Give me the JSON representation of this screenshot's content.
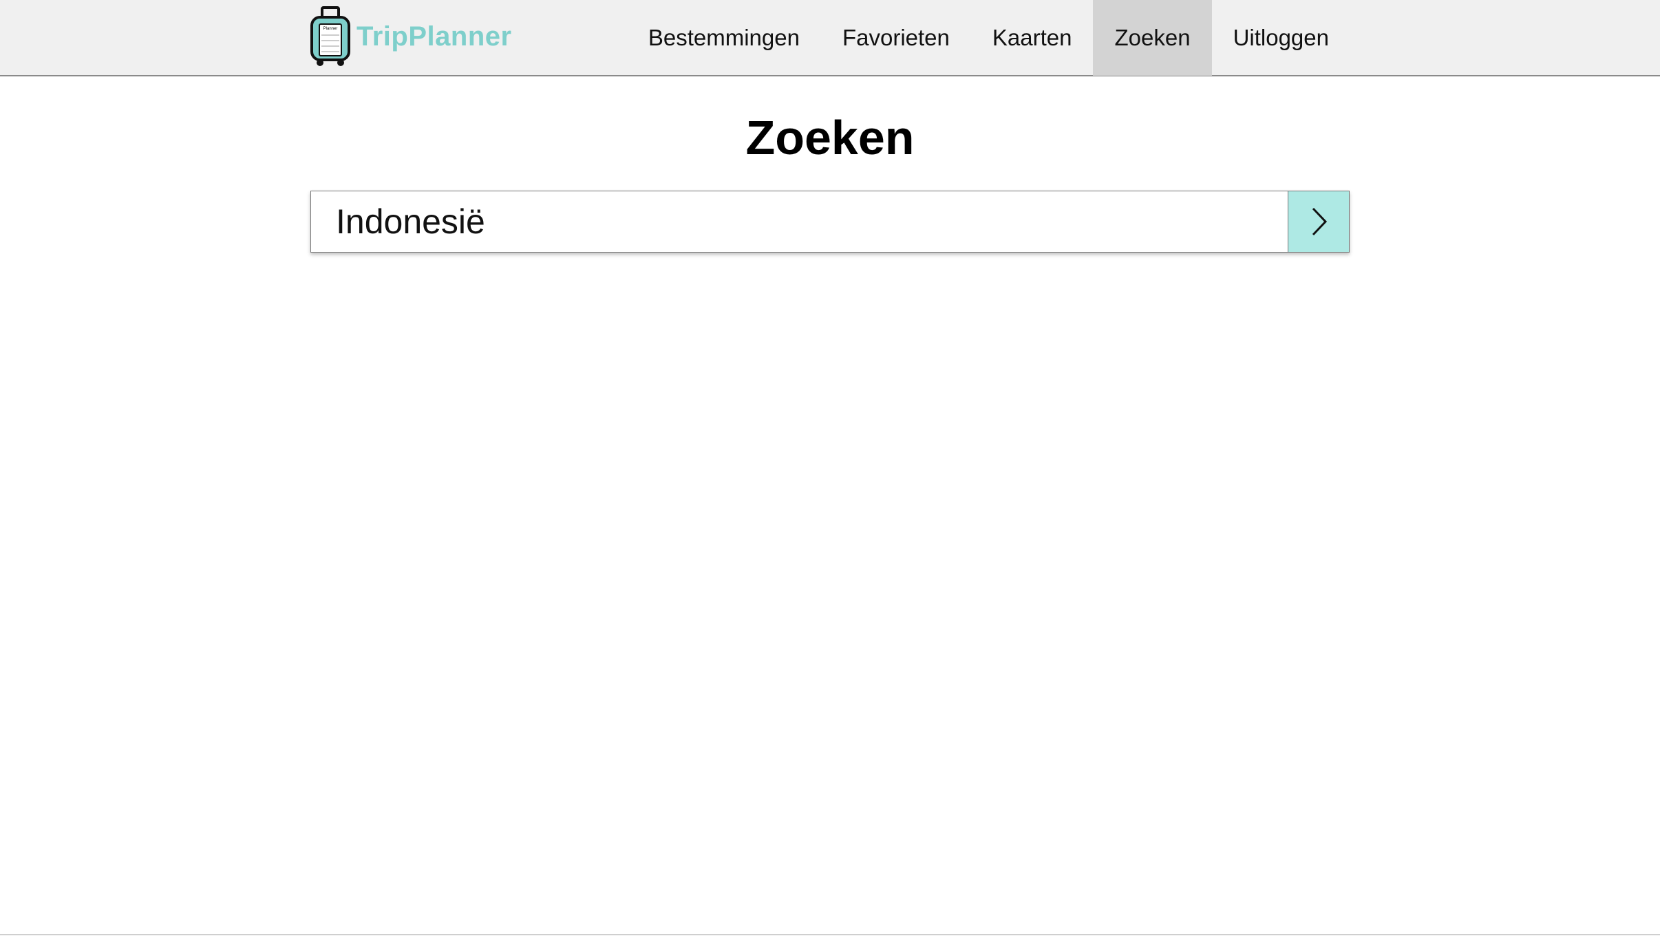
{
  "brand": {
    "name": "TripPlanner",
    "accent_color": "#7ecfcb",
    "logo_icon": "suitcase-icon"
  },
  "nav": {
    "items": [
      {
        "label": "Bestemmingen",
        "active": false
      },
      {
        "label": "Favorieten",
        "active": false
      },
      {
        "label": "Kaarten",
        "active": false
      },
      {
        "label": "Zoeken",
        "active": true
      },
      {
        "label": "Uitloggen",
        "active": false
      }
    ]
  },
  "main": {
    "title": "Zoeken",
    "search": {
      "value": "Indonesië",
      "button_icon": "chevron-right-icon",
      "button_color": "#aee9e4"
    }
  }
}
